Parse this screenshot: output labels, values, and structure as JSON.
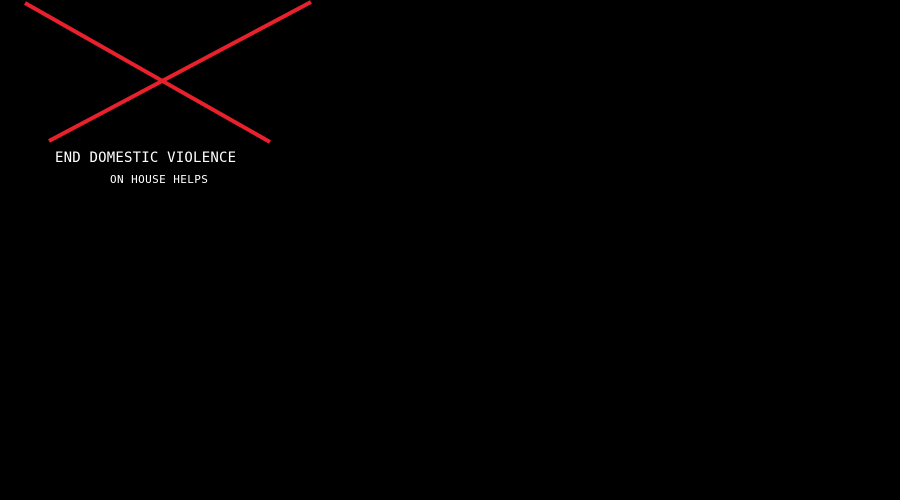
{
  "graphic": {
    "background_color": "#000000",
    "cross_color": "#e8212d",
    "cross_icon": "red-x-mark"
  },
  "message": {
    "headline": "END DOMESTIC VIOLENCE",
    "subline": "ON HOUSE HELPS"
  }
}
